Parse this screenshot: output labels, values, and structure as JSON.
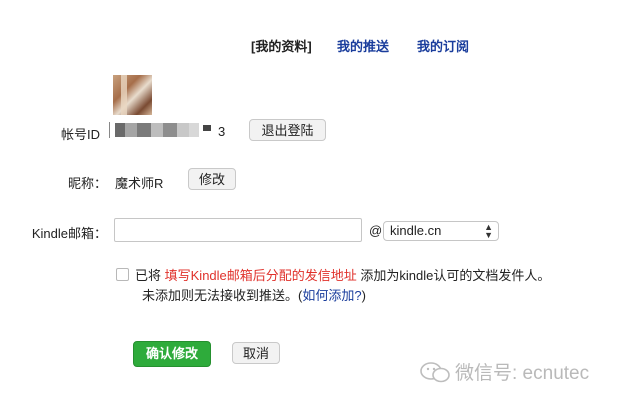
{
  "nav": {
    "profile": "[我的资料]",
    "push": "我的推送",
    "subscriptions": "我的订阅"
  },
  "account": {
    "label": "帐号ID",
    "value_suffix": "3",
    "logout_button": "退出登陆"
  },
  "nickname": {
    "label": "昵称：",
    "value": "魔术师R",
    "edit_button": "修改"
  },
  "kindle": {
    "label": "Kindle邮箱：",
    "input_value": "",
    "at": "@",
    "domain_selected": "kindle.cn"
  },
  "notice": {
    "prefix": "已将",
    "highlight": "填写Kindle邮箱后分配的发信地址",
    "suffix": "添加为kindle认可的文档发件人。",
    "line2": "未添加则无法接收到推送。(",
    "link": "如何添加?",
    "line2_end": ")"
  },
  "actions": {
    "confirm": "确认修改",
    "cancel": "取消"
  },
  "watermark": {
    "text": "微信号: ecnutec"
  },
  "colors": {
    "link": "#1a3d9c",
    "highlight": "#e0312b",
    "confirm": "#2eab3b"
  }
}
